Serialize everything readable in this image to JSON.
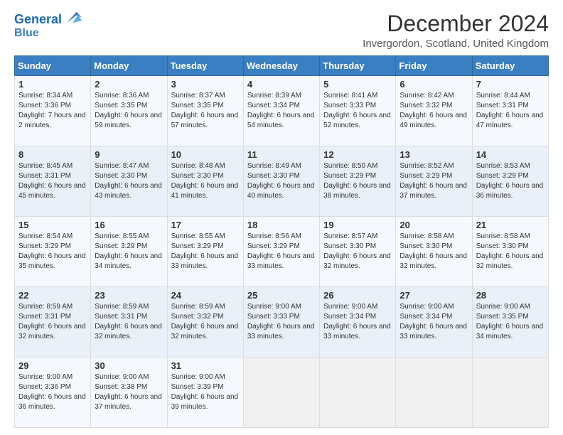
{
  "header": {
    "logo_line1": "General",
    "logo_line2": "Blue",
    "title": "December 2024",
    "subtitle": "Invergordon, Scotland, United Kingdom"
  },
  "days_of_week": [
    "Sunday",
    "Monday",
    "Tuesday",
    "Wednesday",
    "Thursday",
    "Friday",
    "Saturday"
  ],
  "weeks": [
    [
      {
        "day": "1",
        "sunrise": "Sunrise: 8:34 AM",
        "sunset": "Sunset: 3:36 PM",
        "daylight": "Daylight: 7 hours and 2 minutes."
      },
      {
        "day": "2",
        "sunrise": "Sunrise: 8:36 AM",
        "sunset": "Sunset: 3:35 PM",
        "daylight": "Daylight: 6 hours and 59 minutes."
      },
      {
        "day": "3",
        "sunrise": "Sunrise: 8:37 AM",
        "sunset": "Sunset: 3:35 PM",
        "daylight": "Daylight: 6 hours and 57 minutes."
      },
      {
        "day": "4",
        "sunrise": "Sunrise: 8:39 AM",
        "sunset": "Sunset: 3:34 PM",
        "daylight": "Daylight: 6 hours and 54 minutes."
      },
      {
        "day": "5",
        "sunrise": "Sunrise: 8:41 AM",
        "sunset": "Sunset: 3:33 PM",
        "daylight": "Daylight: 6 hours and 52 minutes."
      },
      {
        "day": "6",
        "sunrise": "Sunrise: 8:42 AM",
        "sunset": "Sunset: 3:32 PM",
        "daylight": "Daylight: 6 hours and 49 minutes."
      },
      {
        "day": "7",
        "sunrise": "Sunrise: 8:44 AM",
        "sunset": "Sunset: 3:31 PM",
        "daylight": "Daylight: 6 hours and 47 minutes."
      }
    ],
    [
      {
        "day": "8",
        "sunrise": "Sunrise: 8:45 AM",
        "sunset": "Sunset: 3:31 PM",
        "daylight": "Daylight: 6 hours and 45 minutes."
      },
      {
        "day": "9",
        "sunrise": "Sunrise: 8:47 AM",
        "sunset": "Sunset: 3:30 PM",
        "daylight": "Daylight: 6 hours and 43 minutes."
      },
      {
        "day": "10",
        "sunrise": "Sunrise: 8:48 AM",
        "sunset": "Sunset: 3:30 PM",
        "daylight": "Daylight: 6 hours and 41 minutes."
      },
      {
        "day": "11",
        "sunrise": "Sunrise: 8:49 AM",
        "sunset": "Sunset: 3:30 PM",
        "daylight": "Daylight: 6 hours and 40 minutes."
      },
      {
        "day": "12",
        "sunrise": "Sunrise: 8:50 AM",
        "sunset": "Sunset: 3:29 PM",
        "daylight": "Daylight: 6 hours and 38 minutes."
      },
      {
        "day": "13",
        "sunrise": "Sunrise: 8:52 AM",
        "sunset": "Sunset: 3:29 PM",
        "daylight": "Daylight: 6 hours and 37 minutes."
      },
      {
        "day": "14",
        "sunrise": "Sunrise: 8:53 AM",
        "sunset": "Sunset: 3:29 PM",
        "daylight": "Daylight: 6 hours and 36 minutes."
      }
    ],
    [
      {
        "day": "15",
        "sunrise": "Sunrise: 8:54 AM",
        "sunset": "Sunset: 3:29 PM",
        "daylight": "Daylight: 6 hours and 35 minutes."
      },
      {
        "day": "16",
        "sunrise": "Sunrise: 8:55 AM",
        "sunset": "Sunset: 3:29 PM",
        "daylight": "Daylight: 6 hours and 34 minutes."
      },
      {
        "day": "17",
        "sunrise": "Sunrise: 8:55 AM",
        "sunset": "Sunset: 3:29 PM",
        "daylight": "Daylight: 6 hours and 33 minutes."
      },
      {
        "day": "18",
        "sunrise": "Sunrise: 8:56 AM",
        "sunset": "Sunset: 3:29 PM",
        "daylight": "Daylight: 6 hours and 33 minutes."
      },
      {
        "day": "19",
        "sunrise": "Sunrise: 8:57 AM",
        "sunset": "Sunset: 3:30 PM",
        "daylight": "Daylight: 6 hours and 32 minutes."
      },
      {
        "day": "20",
        "sunrise": "Sunrise: 8:58 AM",
        "sunset": "Sunset: 3:30 PM",
        "daylight": "Daylight: 6 hours and 32 minutes."
      },
      {
        "day": "21",
        "sunrise": "Sunrise: 8:58 AM",
        "sunset": "Sunset: 3:30 PM",
        "daylight": "Daylight: 6 hours and 32 minutes."
      }
    ],
    [
      {
        "day": "22",
        "sunrise": "Sunrise: 8:59 AM",
        "sunset": "Sunset: 3:31 PM",
        "daylight": "Daylight: 6 hours and 32 minutes."
      },
      {
        "day": "23",
        "sunrise": "Sunrise: 8:59 AM",
        "sunset": "Sunset: 3:31 PM",
        "daylight": "Daylight: 6 hours and 32 minutes."
      },
      {
        "day": "24",
        "sunrise": "Sunrise: 8:59 AM",
        "sunset": "Sunset: 3:32 PM",
        "daylight": "Daylight: 6 hours and 32 minutes."
      },
      {
        "day": "25",
        "sunrise": "Sunrise: 9:00 AM",
        "sunset": "Sunset: 3:33 PM",
        "daylight": "Daylight: 6 hours and 33 minutes."
      },
      {
        "day": "26",
        "sunrise": "Sunrise: 9:00 AM",
        "sunset": "Sunset: 3:34 PM",
        "daylight": "Daylight: 6 hours and 33 minutes."
      },
      {
        "day": "27",
        "sunrise": "Sunrise: 9:00 AM",
        "sunset": "Sunset: 3:34 PM",
        "daylight": "Daylight: 6 hours and 33 minutes."
      },
      {
        "day": "28",
        "sunrise": "Sunrise: 9:00 AM",
        "sunset": "Sunset: 3:35 PM",
        "daylight": "Daylight: 6 hours and 34 minutes."
      }
    ],
    [
      {
        "day": "29",
        "sunrise": "Sunrise: 9:00 AM",
        "sunset": "Sunset: 3:36 PM",
        "daylight": "Daylight: 6 hours and 36 minutes."
      },
      {
        "day": "30",
        "sunrise": "Sunrise: 9:00 AM",
        "sunset": "Sunset: 3:38 PM",
        "daylight": "Daylight: 6 hours and 37 minutes."
      },
      {
        "day": "31",
        "sunrise": "Sunrise: 9:00 AM",
        "sunset": "Sunset: 3:39 PM",
        "daylight": "Daylight: 6 hours and 39 minutes."
      },
      null,
      null,
      null,
      null
    ]
  ]
}
